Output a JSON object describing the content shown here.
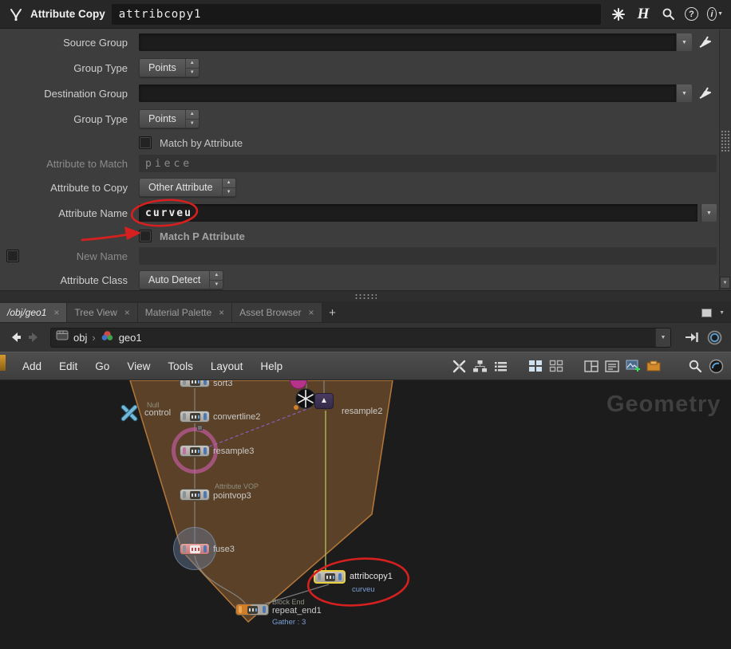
{
  "colors": {
    "annotation_red": "#d62020",
    "backdrop_brown": "#5e4428",
    "current_node_yellow": "#e6d040"
  },
  "titlebar": {
    "title": "Attribute Copy",
    "node_name": "attribcopy1"
  },
  "params": {
    "source_group": {
      "label": "Source Group",
      "value": ""
    },
    "group_type_1": {
      "label": "Group Type",
      "value": "Points"
    },
    "destination_group": {
      "label": "Destination Group",
      "value": ""
    },
    "group_type_2": {
      "label": "Group Type",
      "value": "Points"
    },
    "match_by_attribute": {
      "label": "Match by Attribute",
      "checked": false
    },
    "attribute_to_match": {
      "label": "Attribute to Match",
      "value": "piece"
    },
    "attribute_to_copy": {
      "label": "Attribute to Copy",
      "value": "Other Attribute"
    },
    "attribute_name": {
      "label": "Attribute Name",
      "value": "curveu"
    },
    "match_p_attribute": {
      "label": "Match P Attribute",
      "checked": false
    },
    "new_name": {
      "label": "New Name",
      "value": "",
      "checked": false
    },
    "attribute_class": {
      "label": "Attribute Class",
      "value": "Auto Detect"
    }
  },
  "icons": {
    "close": "×",
    "plus": "+",
    "dropdown": "▼",
    "spin_up": "▲",
    "spin_down": "▼",
    "chevron": "›",
    "help": "?",
    "houdini": "H",
    "arrow_up": "▲"
  },
  "tabs": {
    "items": [
      {
        "label": "/obj/geo1",
        "active": true
      },
      {
        "label": "Tree View",
        "active": false
      },
      {
        "label": "Material Palette",
        "active": false
      },
      {
        "label": "Asset Browser",
        "active": false
      }
    ]
  },
  "pathbar": {
    "context": "obj",
    "node": "geo1"
  },
  "menubar": {
    "items": [
      "Add",
      "Edit",
      "Go",
      "View",
      "Tools",
      "Layout",
      "Help"
    ]
  },
  "network": {
    "watermark": "Geometry",
    "nodes": {
      "sort3": {
        "label": "sort3"
      },
      "resample2": {
        "label": "resample2"
      },
      "control": {
        "type": "Null",
        "label": "control"
      },
      "convertline2": {
        "label": "convertline2"
      },
      "resample3": {
        "label": "resample3"
      },
      "pointvop3": {
        "type": "Attribute VOP",
        "label": "pointvop3"
      },
      "fuse3": {
        "label": "fuse3"
      },
      "attribcopy1": {
        "label": "attribcopy1",
        "info": "curveu"
      },
      "repeat_end1": {
        "type": "Block End",
        "label": "repeat_end1",
        "info": "Gather : 3"
      }
    }
  }
}
